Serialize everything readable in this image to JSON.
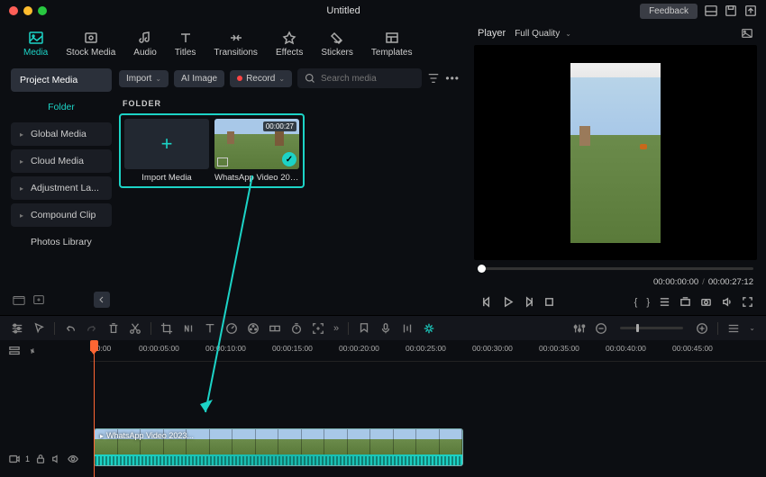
{
  "titlebar": {
    "title": "Untitled",
    "feedback": "Feedback"
  },
  "tabs": [
    {
      "label": "Media",
      "active": true
    },
    {
      "label": "Stock Media"
    },
    {
      "label": "Audio"
    },
    {
      "label": "Titles"
    },
    {
      "label": "Transitions"
    },
    {
      "label": "Effects"
    },
    {
      "label": "Stickers"
    },
    {
      "label": "Templates"
    }
  ],
  "sidebar": {
    "project_media": "Project Media",
    "folder_label": "Folder",
    "items": [
      {
        "label": "Global Media"
      },
      {
        "label": "Cloud Media"
      },
      {
        "label": "Adjustment La..."
      },
      {
        "label": "Compound Clip"
      },
      {
        "label": "Photos Library"
      }
    ]
  },
  "browser": {
    "import": "Import",
    "ai_image": "AI Image",
    "record": "Record",
    "search_placeholder": "Search media",
    "folder_heading": "FOLDER",
    "clips": [
      {
        "label": "Import Media",
        "is_import": true
      },
      {
        "label": "WhatsApp Video 202...",
        "duration": "00:00:27"
      }
    ]
  },
  "player": {
    "label": "Player",
    "quality": "Full Quality",
    "current_time": "00:00:00:00",
    "total_time": "00:00:27:12"
  },
  "timeline": {
    "marks": [
      "00:00",
      "00:00:05:00",
      "00:00:10:00",
      "00:00:15:00",
      "00:00:20:00",
      "00:00:25:00",
      "00:00:30:00",
      "00:00:35:00",
      "00:00:40:00",
      "00:00:45:00"
    ],
    "clip_label": "WhatsApp Video 2023...",
    "track_badge": "1"
  }
}
